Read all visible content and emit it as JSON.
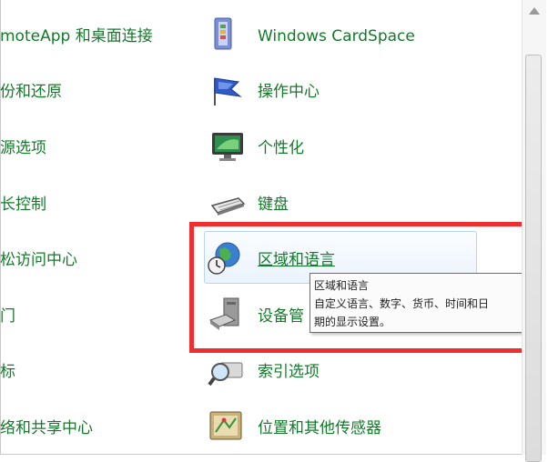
{
  "left_column": [
    "moteApp 和桌面连接",
    "份和还原",
    "源选项",
    "长控制",
    "松访问中心",
    "门",
    "标",
    "络和共享中心"
  ],
  "right_column": [
    {
      "label": "Windows CardSpace",
      "icon": "cardspace-icon"
    },
    {
      "label": "操作中心",
      "icon": "action-center-flag-icon"
    },
    {
      "label": "个性化",
      "icon": "personalization-monitor-icon"
    },
    {
      "label": "键盘",
      "icon": "keyboard-icon"
    },
    {
      "label": "区域和语言",
      "icon": "region-globe-clock-icon"
    },
    {
      "label": "设备管",
      "icon": "device-manager-icon"
    },
    {
      "label": "索引选项",
      "icon": "indexing-magnifier-icon"
    },
    {
      "label": "位置和其他传感器",
      "icon": "location-sensors-icon"
    }
  ],
  "tooltip": {
    "title": "区域和语言",
    "line1": "自定义语言、数字、货币、时间和日",
    "line2": "期的显示设置。"
  },
  "colors": {
    "link_green": "#137a2a",
    "highlight_red": "#ef2f2f"
  }
}
